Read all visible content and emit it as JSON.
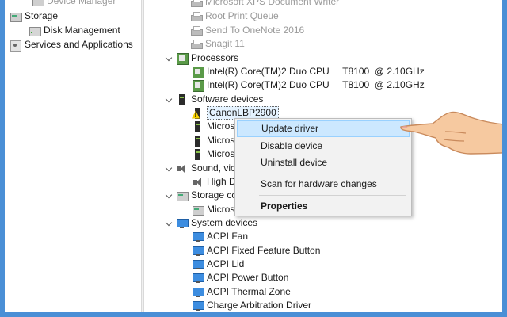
{
  "left_pane": {
    "items": [
      {
        "label": "Device Manager",
        "icon": "device-manager-icon"
      },
      {
        "label": "Storage",
        "icon": "storage-icon"
      },
      {
        "label": "Disk Management",
        "icon": "disk-icon"
      },
      {
        "label": "Services and Applications",
        "icon": "services-icon"
      }
    ]
  },
  "tree": {
    "printers": [
      "Microsoft XPS Document Writer",
      "Root Print Queue",
      "Send To OneNote 2016",
      "Snagit 11"
    ],
    "processors": {
      "label": "Processors",
      "items": [
        "Intel(R) Core(TM)2 Duo CPU     T8100  @ 2.10GHz",
        "Intel(R) Core(TM)2 Duo CPU     T8100  @ 2.10GHz"
      ]
    },
    "software": {
      "label": "Software devices",
      "items": [
        "CanonLBP2900",
        "Micros",
        "Micros",
        "Micros"
      ]
    },
    "sound": {
      "label": "Sound, vic",
      "items": [
        "High D"
      ]
    },
    "storage": {
      "label": "Storage cc",
      "items": [
        "Micros"
      ]
    },
    "system": {
      "label": "System devices",
      "items": [
        "ACPI Fan",
        "ACPI Fixed Feature Button",
        "ACPI Lid",
        "ACPI Power Button",
        "ACPI Thermal Zone",
        "Charge Arbitration Driver"
      ]
    }
  },
  "context_menu": {
    "update": "Update driver",
    "disable": "Disable device",
    "uninstall": "Uninstall device",
    "scan": "Scan for hardware changes",
    "properties": "Properties"
  },
  "colors": {
    "frame_border": "#4a8fd6",
    "highlight": "#cce8ff",
    "menu_bg": "#f2f2f2"
  }
}
